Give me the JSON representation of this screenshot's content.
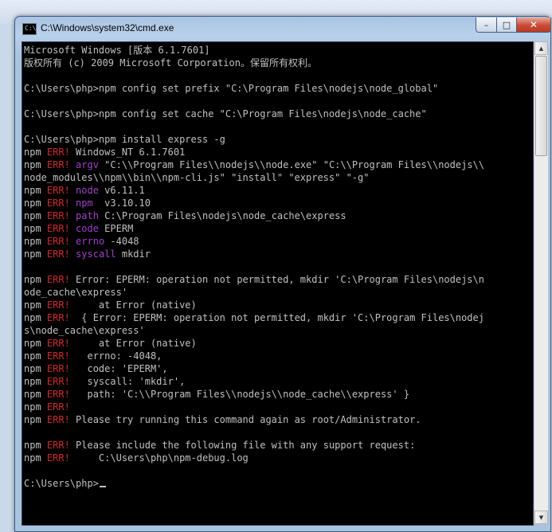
{
  "window": {
    "title": "C:\\Windows\\system32\\cmd.exe",
    "icon_label": "C:\\",
    "controls": {
      "minimize": "–",
      "maximize": "□",
      "close": "✕"
    }
  },
  "console": {
    "lines": [
      [
        {
          "t": "Microsoft Windows [版本 6.1.7601]"
        }
      ],
      [
        {
          "t": "版权所有 (c) 2009 Microsoft Corporation。保留所有权利。"
        }
      ],
      [
        {
          "t": ""
        }
      ],
      [
        {
          "t": "C:\\Users\\php>npm config set prefix \"C:\\Program Files\\nodejs\\node_global\""
        }
      ],
      [
        {
          "t": ""
        }
      ],
      [
        {
          "t": "C:\\Users\\php>npm config set cache \"C:\\Program Files\\nodejs\\node_cache\""
        }
      ],
      [
        {
          "t": ""
        }
      ],
      [
        {
          "t": "C:\\Users\\php>npm install express -g"
        }
      ],
      [
        {
          "t": "npm "
        },
        {
          "t": "ERR!",
          "c": "err"
        },
        {
          "t": " Windows_NT 6.1.7601"
        }
      ],
      [
        {
          "t": "npm "
        },
        {
          "t": "ERR!",
          "c": "err"
        },
        {
          "t": " "
        },
        {
          "t": "argv",
          "c": "key"
        },
        {
          "t": " \"C:\\\\Program Files\\\\nodejs\\\\node.exe\" \"C:\\\\Program Files\\\\nodejs\\\\"
        }
      ],
      [
        {
          "t": "node_modules\\\\npm\\\\bin\\\\npm-cli.js\" \"install\" \"express\" \"-g\""
        }
      ],
      [
        {
          "t": "npm "
        },
        {
          "t": "ERR!",
          "c": "err"
        },
        {
          "t": " "
        },
        {
          "t": "node",
          "c": "key"
        },
        {
          "t": " v6.11.1"
        }
      ],
      [
        {
          "t": "npm "
        },
        {
          "t": "ERR!",
          "c": "err"
        },
        {
          "t": " "
        },
        {
          "t": "npm",
          "c": "key"
        },
        {
          "t": "  v3.10.10"
        }
      ],
      [
        {
          "t": "npm "
        },
        {
          "t": "ERR!",
          "c": "err"
        },
        {
          "t": " "
        },
        {
          "t": "path",
          "c": "key"
        },
        {
          "t": " C:\\Program Files\\nodejs\\node_cache\\express"
        }
      ],
      [
        {
          "t": "npm "
        },
        {
          "t": "ERR!",
          "c": "err"
        },
        {
          "t": " "
        },
        {
          "t": "code",
          "c": "key"
        },
        {
          "t": " EPERM"
        }
      ],
      [
        {
          "t": "npm "
        },
        {
          "t": "ERR!",
          "c": "err"
        },
        {
          "t": " "
        },
        {
          "t": "errno",
          "c": "key"
        },
        {
          "t": " -4048"
        }
      ],
      [
        {
          "t": "npm "
        },
        {
          "t": "ERR!",
          "c": "err"
        },
        {
          "t": " "
        },
        {
          "t": "syscall",
          "c": "key"
        },
        {
          "t": " mkdir"
        }
      ],
      [
        {
          "t": ""
        }
      ],
      [
        {
          "t": "npm "
        },
        {
          "t": "ERR!",
          "c": "err"
        },
        {
          "t": " Error: EPERM: operation not permitted, mkdir 'C:\\Program Files\\nodejs\\n"
        }
      ],
      [
        {
          "t": "ode_cache\\express'"
        }
      ],
      [
        {
          "t": "npm "
        },
        {
          "t": "ERR!",
          "c": "err"
        },
        {
          "t": "     at Error (native)"
        }
      ],
      [
        {
          "t": "npm "
        },
        {
          "t": "ERR!",
          "c": "err"
        },
        {
          "t": "  { Error: EPERM: operation not permitted, mkdir 'C:\\Program Files\\nodej"
        }
      ],
      [
        {
          "t": "s\\node_cache\\express'"
        }
      ],
      [
        {
          "t": "npm "
        },
        {
          "t": "ERR!",
          "c": "err"
        },
        {
          "t": "     at Error (native)"
        }
      ],
      [
        {
          "t": "npm "
        },
        {
          "t": "ERR!",
          "c": "err"
        },
        {
          "t": "   errno: -4048,"
        }
      ],
      [
        {
          "t": "npm "
        },
        {
          "t": "ERR!",
          "c": "err"
        },
        {
          "t": "   code: 'EPERM',"
        }
      ],
      [
        {
          "t": "npm "
        },
        {
          "t": "ERR!",
          "c": "err"
        },
        {
          "t": "   syscall: 'mkdir',"
        }
      ],
      [
        {
          "t": "npm "
        },
        {
          "t": "ERR!",
          "c": "err"
        },
        {
          "t": "   path: 'C:\\\\Program Files\\\\nodejs\\\\node_cache\\\\express' }"
        }
      ],
      [
        {
          "t": "npm "
        },
        {
          "t": "ERR!",
          "c": "err"
        }
      ],
      [
        {
          "t": "npm "
        },
        {
          "t": "ERR!",
          "c": "err"
        },
        {
          "t": " Please try running this command again as root/Administrator."
        }
      ],
      [
        {
          "t": ""
        }
      ],
      [
        {
          "t": "npm "
        },
        {
          "t": "ERR!",
          "c": "err"
        },
        {
          "t": " Please include the following file with any support request:"
        }
      ],
      [
        {
          "t": "npm "
        },
        {
          "t": "ERR!",
          "c": "err"
        },
        {
          "t": "     C:\\Users\\php\\npm-debug.log"
        }
      ],
      [
        {
          "t": ""
        }
      ]
    ],
    "prompt": "C:\\Users\\php>"
  },
  "scrollbar": {
    "up_glyph": "▲",
    "down_glyph": "▼"
  },
  "colors": {
    "console_bg": "#000000",
    "console_text": "#c0c0c0",
    "err": "#cc2a2a",
    "key": "#a040c8",
    "close_button": "#c94a35"
  }
}
